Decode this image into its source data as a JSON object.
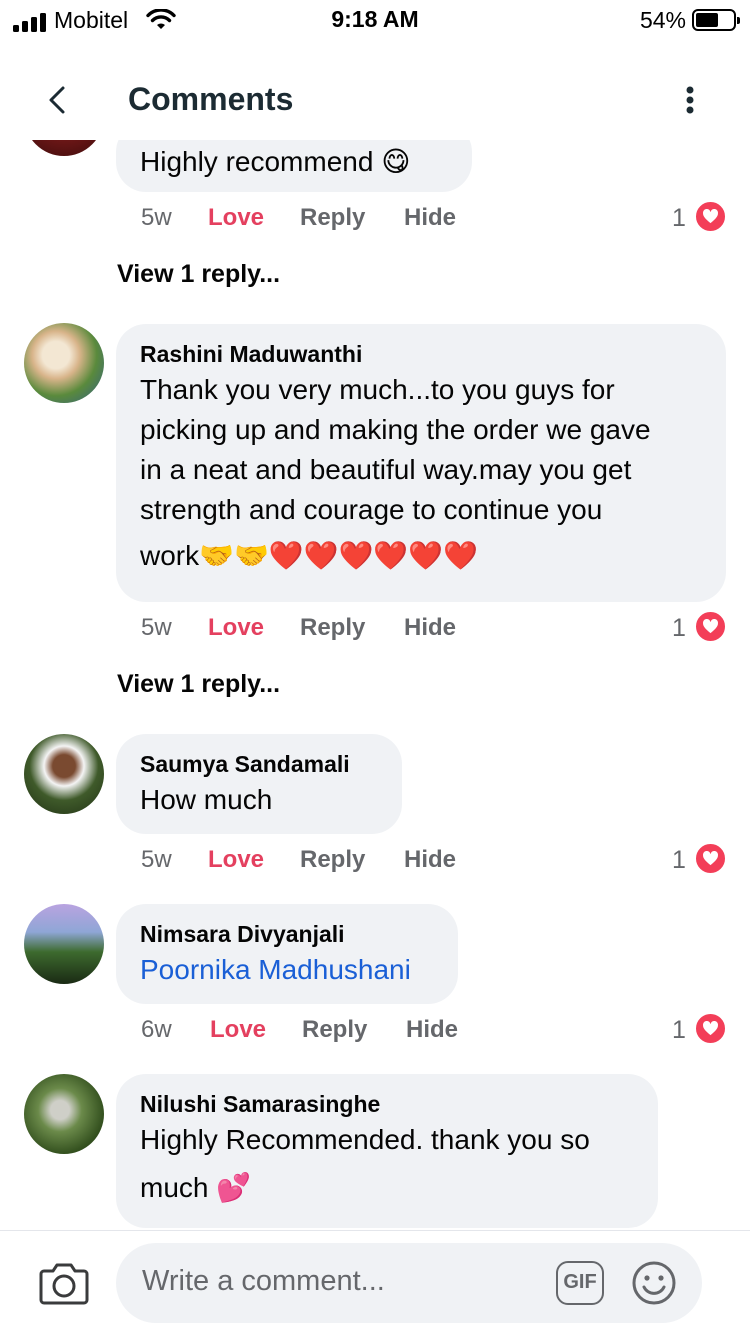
{
  "status_bar": {
    "carrier": "Mobitel",
    "time": "9:18 AM",
    "battery": "54%",
    "battery_level": 0.54
  },
  "header": {
    "title": "Comments",
    "back_icon": "chevron-left-icon",
    "menu_icon": "more-vertical-icon"
  },
  "actions": {
    "love": "Love",
    "reply": "Reply",
    "hide": "Hide"
  },
  "comments": [
    {
      "text": "Highly recommend 😋",
      "age": "5w",
      "reactions": "1",
      "view_replies": "View 1 reply..."
    },
    {
      "author": "Rashini Maduwanthi",
      "lines": [
        "Thank you very much...to you guys for",
        "picking up and making the order we gave",
        "in a neat and beautiful way.may you get",
        "strength and courage to continue you",
        "work🤝🤝❤️❤️❤️❤️❤️❤️"
      ],
      "age": "5w",
      "reactions": "1",
      "view_replies": "View 1 reply..."
    },
    {
      "author": "Saumya Sandamali",
      "text": "How much",
      "age": "5w",
      "reactions": "1"
    },
    {
      "author": "Nimsara Divyanjali",
      "mention": "Poornika Madhushani",
      "age": "6w",
      "reactions": "1"
    },
    {
      "author": "Nilushi Samarasinghe",
      "lines": [
        "Highly Recommended. thank you so",
        "much 💕"
      ]
    }
  ],
  "composer": {
    "placeholder": "Write a comment...",
    "gif_label": "GIF",
    "camera_icon": "camera-icon",
    "emoji_icon": "smiley-icon"
  },
  "colors": {
    "love": "#e4405f",
    "heart_badge": "#f33e58",
    "mention": "#1a5fd6",
    "bubble": "#f0f2f5",
    "muted": "#65676b"
  }
}
